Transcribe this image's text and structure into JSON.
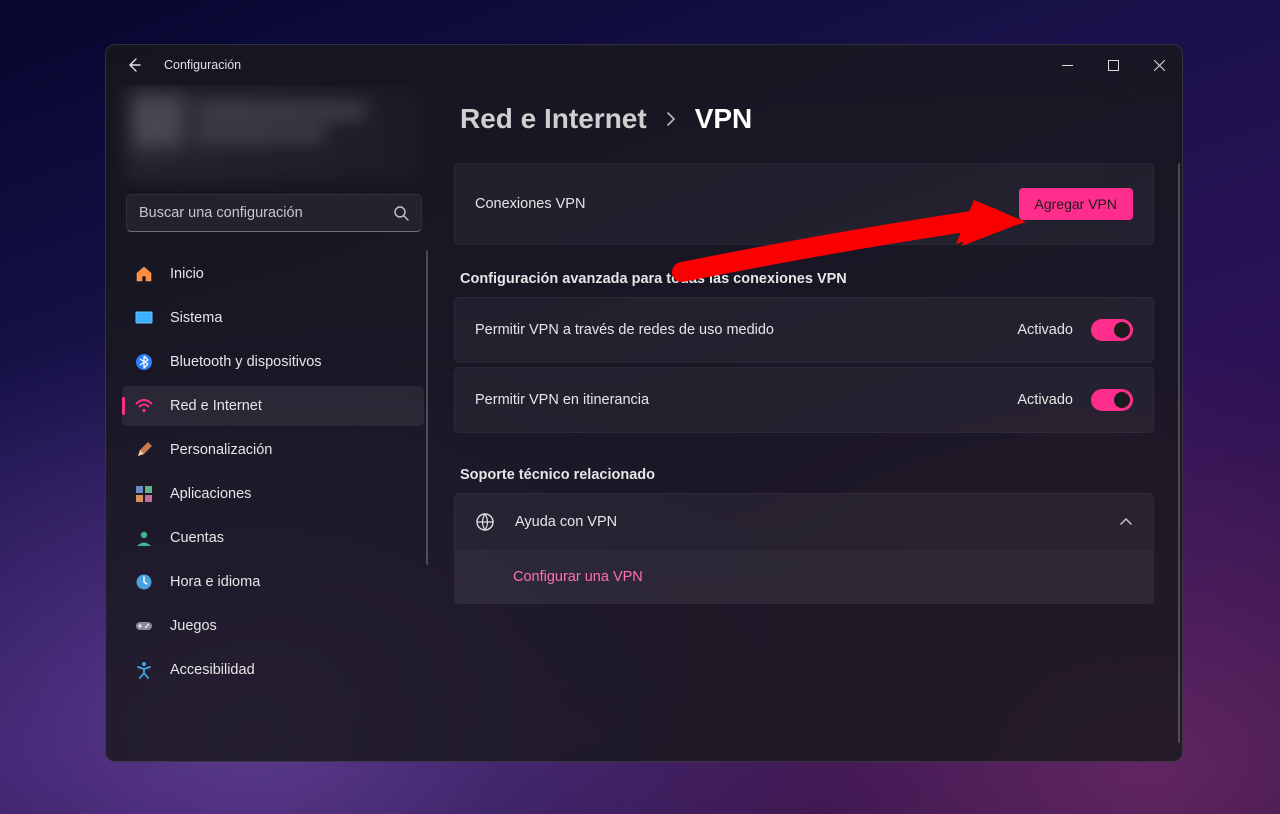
{
  "window": {
    "title": "Configuración"
  },
  "search": {
    "placeholder": "Buscar una configuración"
  },
  "sidebar": {
    "items": [
      {
        "label": "Inicio"
      },
      {
        "label": "Sistema"
      },
      {
        "label": "Bluetooth y dispositivos"
      },
      {
        "label": "Red e Internet"
      },
      {
        "label": "Personalización"
      },
      {
        "label": "Aplicaciones"
      },
      {
        "label": "Cuentas"
      },
      {
        "label": "Hora e idioma"
      },
      {
        "label": "Juegos"
      },
      {
        "label": "Accesibilidad"
      }
    ]
  },
  "breadcrumb": {
    "parent": "Red e Internet",
    "current": "VPN"
  },
  "vpn_connections": {
    "title": "Conexiones VPN",
    "add_button": "Agregar VPN"
  },
  "advanced": {
    "heading": "Configuración avanzada para todas las conexiones VPN",
    "metered": {
      "label": "Permitir VPN a través de redes de uso medido",
      "state": "Activado"
    },
    "roaming": {
      "label": "Permitir VPN en itinerancia",
      "state": "Activado"
    }
  },
  "support": {
    "heading": "Soporte técnico relacionado",
    "help_title": "Ayuda con VPN",
    "link": "Configurar una VPN"
  },
  "colors": {
    "accent": "#ff2e8d"
  }
}
